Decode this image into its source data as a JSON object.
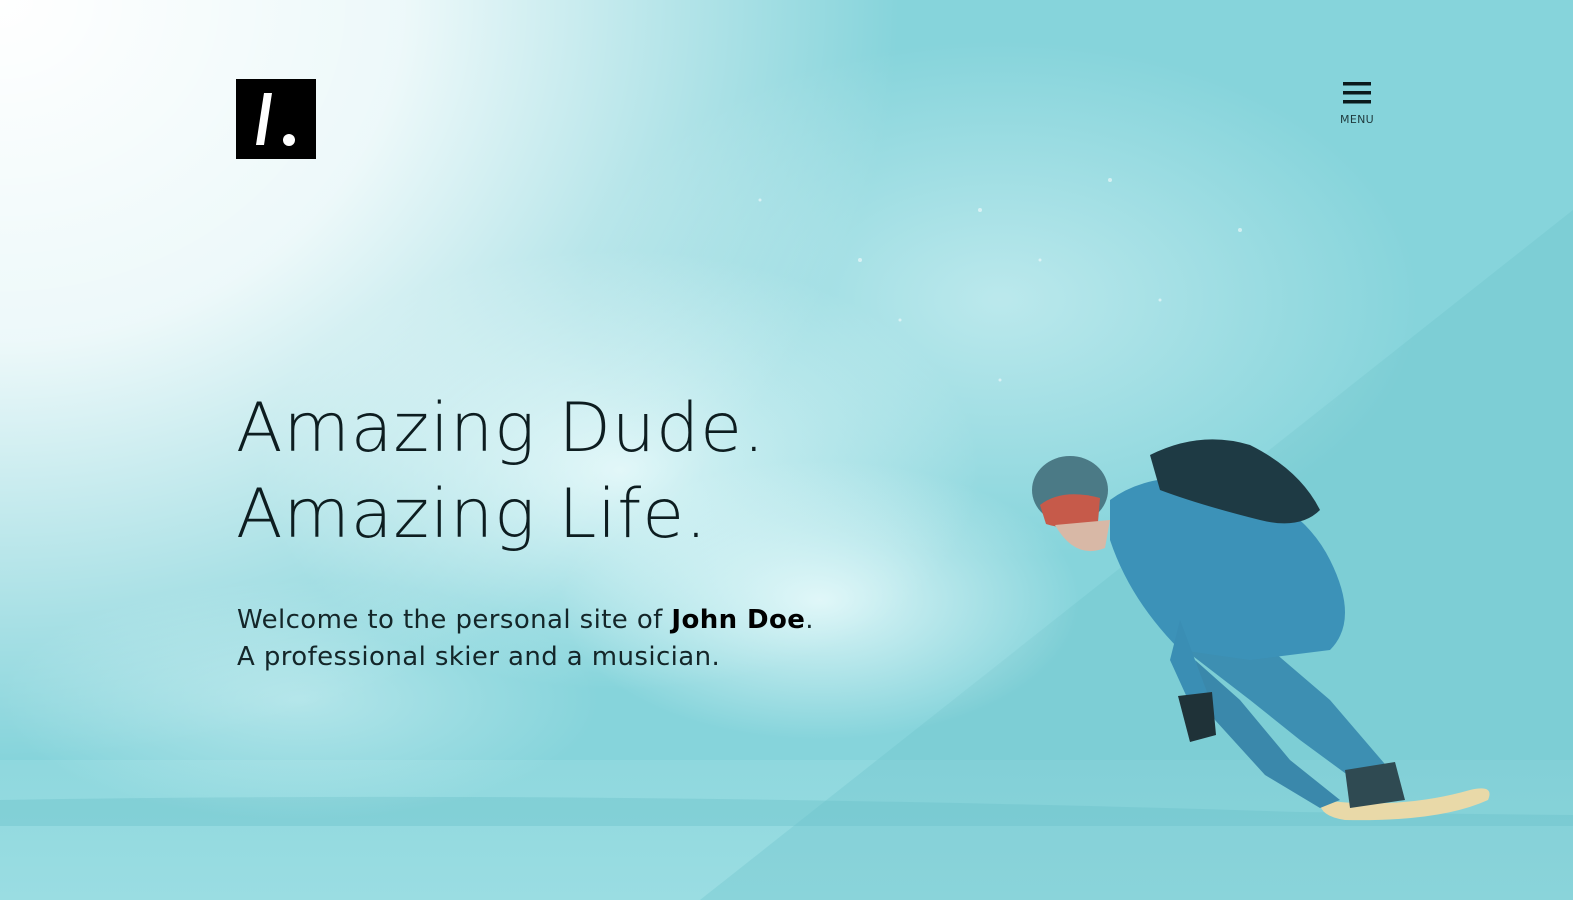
{
  "header": {
    "logo_icon": "slash-dot-logo",
    "menu_icon": "hamburger-icon",
    "menu_label": "MENU"
  },
  "hero": {
    "headline_line1": "Amazing Dude.",
    "headline_line2": "Amazing Life.",
    "intro_prefix": "Welcome to the personal site of ",
    "intro_name": "John Doe",
    "intro_suffix": ".",
    "intro_line2": "A professional skier and a musician."
  },
  "colors": {
    "accent_teal": "#7fd2da",
    "logo_bg": "#000000",
    "text_dark": "#0d1d20"
  }
}
